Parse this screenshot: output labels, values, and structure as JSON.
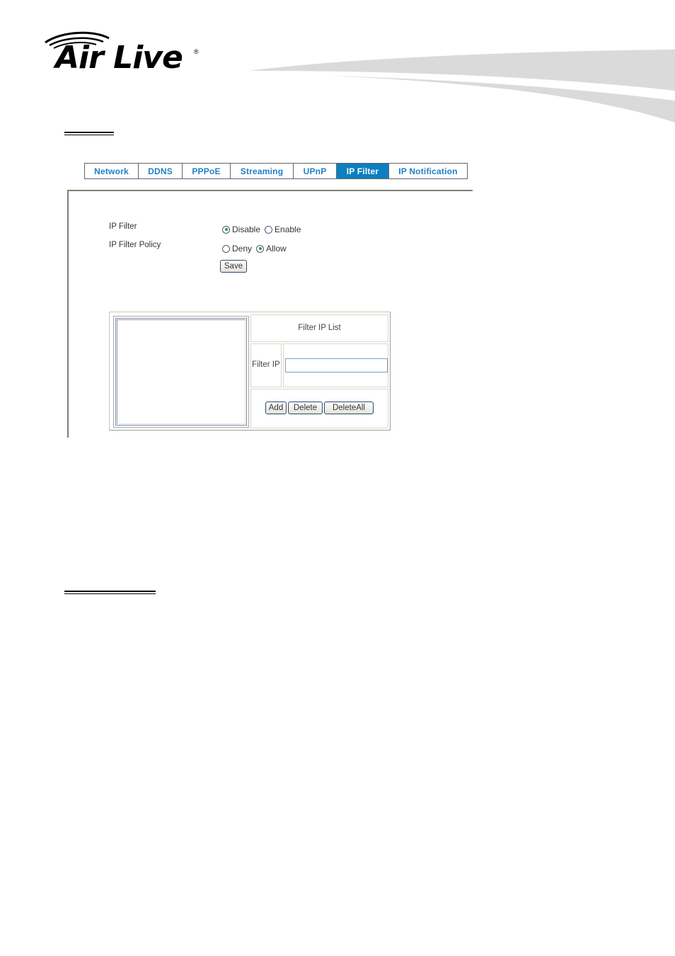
{
  "brand": {
    "logo_text": "Air Live",
    "registered_mark": "®"
  },
  "tabs": [
    {
      "label": "Network",
      "active": false
    },
    {
      "label": "DDNS",
      "active": false
    },
    {
      "label": "PPPoE",
      "active": false
    },
    {
      "label": "Streaming",
      "active": false
    },
    {
      "label": "UPnP",
      "active": false
    },
    {
      "label": "IP Filter",
      "active": true
    },
    {
      "label": "IP Notification",
      "active": false
    }
  ],
  "colors": {
    "tab_text": "#1f7fc6",
    "tab_active_bg": "#0c7fc0",
    "tab_active_text": "#ffffff",
    "radio_dot": "#2a9a3a"
  },
  "form": {
    "ip_filter": {
      "label": "IP Filter",
      "options": [
        {
          "label": "Disable",
          "checked": true
        },
        {
          "label": "Enable",
          "checked": false
        }
      ]
    },
    "ip_filter_policy": {
      "label": "IP Filter Policy",
      "options": [
        {
          "label": "Deny",
          "checked": false
        },
        {
          "label": "Allow",
          "checked": true
        }
      ]
    },
    "save_label": "Save"
  },
  "filter_list": {
    "header": "Filter IP List",
    "ip_label": "Filter IP",
    "ip_value": "",
    "ip_placeholder": "",
    "entries": [],
    "buttons": {
      "add": "Add",
      "delete": "Delete",
      "delete_all": "DeleteAll"
    }
  }
}
